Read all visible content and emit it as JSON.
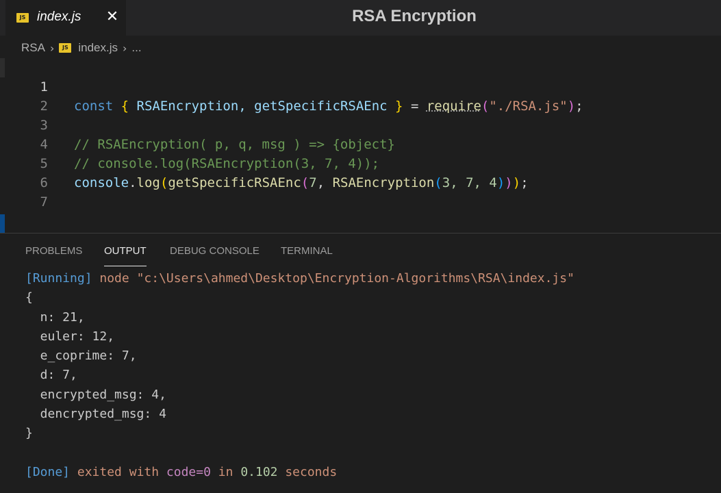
{
  "tab": {
    "icon_text": "JS",
    "label": "index.js",
    "close": "✕"
  },
  "window_title": "RSA Encryption",
  "breadcrumb": {
    "folder": "RSA",
    "file": "index.js",
    "more": "..."
  },
  "editor": {
    "line_numbers": [
      "1",
      "2",
      "3",
      "4",
      "5",
      "6",
      "7"
    ],
    "line1": {
      "const": "const",
      "brace_open": "{",
      "names": " RSAEncryption, getSpecificRSAEnc ",
      "brace_close": "}",
      "eq": " = ",
      "require": "require",
      "paren_open": "(",
      "path": "\"./RSA.js\"",
      "paren_close": ")",
      "semi": ";"
    },
    "line3": "// RSAEncryption( p, q, msg ) => {object}",
    "line4": "// console.log(RSAEncryption(3, 7, 4));",
    "line5": {
      "console": "console",
      "dot": ".",
      "log": "log",
      "p1": "(",
      "fn1": "getSpecificRSAEnc",
      "p2": "(",
      "num7": "7",
      "comma": ", ",
      "fn2": "RSAEncryption",
      "p3": "(",
      "args": "3, 7, 4",
      "p3c": ")",
      "p2c": ")",
      "p1c": ")",
      "semi": ";"
    }
  },
  "panel": {
    "tabs": [
      "PROBLEMS",
      "OUTPUT",
      "DEBUG CONSOLE",
      "TERMINAL"
    ],
    "active_tab": "OUTPUT",
    "output": {
      "running_tag": "[Running]",
      "running_cmd": " node \"c:\\Users\\ahmed\\Desktop\\Encryption-Algorithms\\RSA\\index.js\"",
      "lines": [
        "{",
        "  n: 21,",
        "  euler: 12,",
        "  e_coprime: 7,",
        "  d: 7,",
        "  encrypted_msg: 4,",
        "  dencrypted_msg: 4",
        "}",
        ""
      ],
      "done_tag": "[Done]",
      "done_text1": " exited with ",
      "done_code": "code=0",
      "done_text2": " in ",
      "done_time": "0.102",
      "done_text3": " seconds"
    }
  },
  "colors": {
    "background": "#1e1e1e",
    "keyword": "#569cd6",
    "string": "#ce9178",
    "comment": "#6a9955",
    "number": "#b5cea8",
    "function": "#dcdcaa",
    "bracket_gold": "#ffd700",
    "bracket_orchid": "#da70d6",
    "bracket_blue": "#179fff"
  }
}
